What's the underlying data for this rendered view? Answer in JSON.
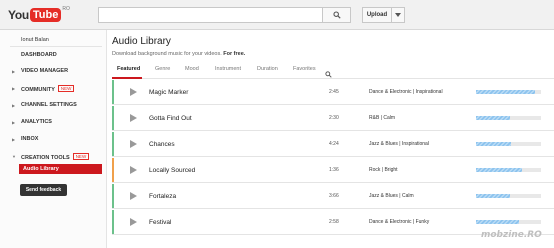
{
  "header": {
    "logo_you": "You",
    "logo_tube": "Tube",
    "logo_region": "RO",
    "search_value": "",
    "upload_label": "Upload"
  },
  "sidebar": {
    "user_name": "Ionut Balan",
    "dashboard": "DASHBOARD",
    "video_manager": "VIDEO MANAGER",
    "community": "COMMUNITY",
    "community_badge": "NEW",
    "channel_settings": "CHANNEL SETTINGS",
    "analytics": "ANALYTICS",
    "inbox": "INBOX",
    "creation_tools": "CREATION TOOLS",
    "creation_tools_badge": "NEW",
    "audio_library": "Audio Library",
    "send_feedback": "Send feedback"
  },
  "main": {
    "title": "Audio Library",
    "subtitle_prefix": "Download background music for your videos. ",
    "subtitle_bold": "For free.",
    "tabs": [
      "Featured",
      "Genre",
      "Mood",
      "Instrument",
      "Duration",
      "Favorites"
    ],
    "tracks": [
      {
        "title": "Magic Marker",
        "duration": "2:45",
        "genre": "Dance & Electronic | Inspirational",
        "accent": "#6cc18b",
        "popularity": 0.9
      },
      {
        "title": "Gotta Find Out",
        "duration": "2:30",
        "genre": "R&B | Calm",
        "accent": "#6cc18b",
        "popularity": 0.52
      },
      {
        "title": "Chances",
        "duration": "4:24",
        "genre": "Jazz & Blues | Inspirational",
        "accent": "#6cc18b",
        "popularity": 0.54
      },
      {
        "title": "Locally Sourced",
        "duration": "1:36",
        "genre": "Rock | Bright",
        "accent": "#f0a04b",
        "popularity": 0.7
      },
      {
        "title": "Fortaleza",
        "duration": "3:66",
        "genre": "Jazz & Blues | Calm",
        "accent": "#6cc18b",
        "popularity": 0.53
      },
      {
        "title": "Festival",
        "duration": "2:58",
        "genre": "Dance & Electronic | Funky",
        "accent": "#6cc18b",
        "popularity": 0.66
      }
    ]
  },
  "watermark": "mobzine.RO"
}
